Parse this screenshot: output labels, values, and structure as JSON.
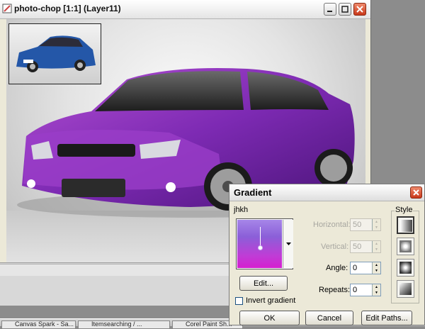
{
  "window": {
    "title": "photo-chop [1:1] (Layer11)",
    "min_icon": "minimize-icon",
    "max_icon": "maximize-icon",
    "close_icon": "close-icon",
    "accent": "#c8381a"
  },
  "canvas": {
    "car_color": "#7a2fb0",
    "thumbnail_car_color": "#2457a8"
  },
  "dialog": {
    "title": "Gradient",
    "gradient_name": "jhkh",
    "gradient_colors": [
      "#a686e8",
      "#8b5fd8",
      "#c03cd6",
      "#d51fcf"
    ],
    "edit_button": "Edit...",
    "invert_label": "Invert gradient",
    "invert_checked": false,
    "horizontal": {
      "label": "Horizontal:",
      "value": "50",
      "enabled": false
    },
    "vertical": {
      "label": "Vertical:",
      "value": "50",
      "enabled": false
    },
    "angle": {
      "label": "Angle:",
      "value": "0",
      "enabled": true
    },
    "repeats": {
      "label": "Repeats:",
      "value": "0",
      "enabled": true
    },
    "style_label": "Style",
    "style_options": [
      "linear-style-icon",
      "rectangular-style-icon",
      "radial-style-icon",
      "conical-style-icon"
    ],
    "selected_style": "linear-style-icon",
    "ok_button": "OK",
    "cancel_button": "Cancel",
    "edit_paths_button": "Edit Paths..."
  },
  "taskbar": {
    "items": [
      "Canvas Spark - Sa...",
      "Itemsearching / ...",
      "Corel Paint Sh..."
    ]
  }
}
